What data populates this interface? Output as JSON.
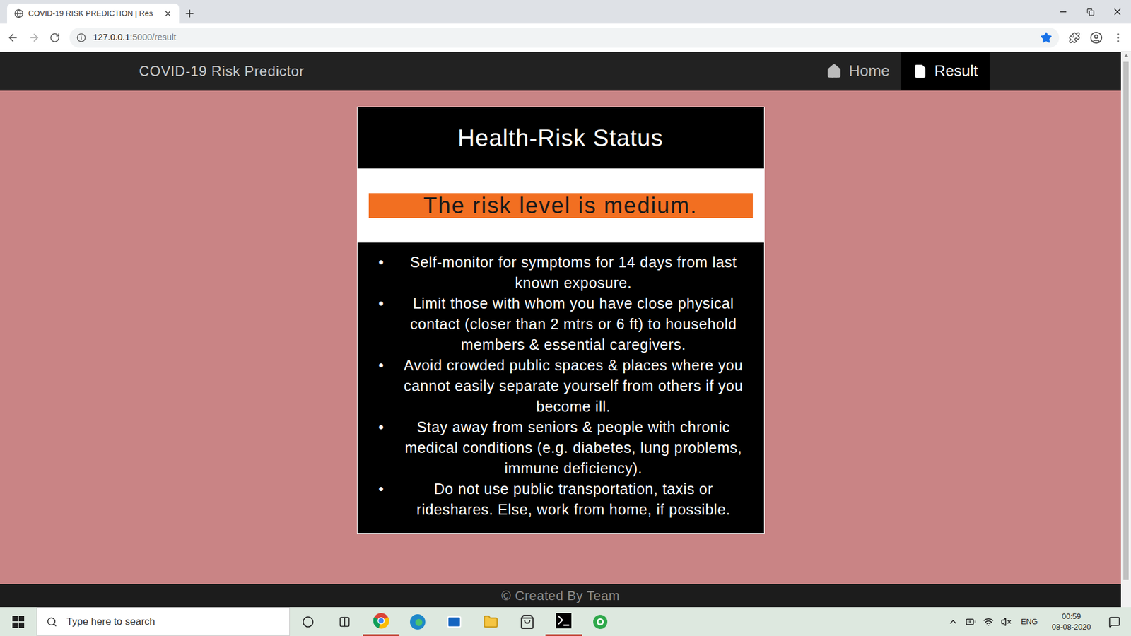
{
  "browser": {
    "tab": {
      "title": "COVID-19 RISK PREDICTION | Res"
    },
    "address": {
      "host": "127.0.0.1",
      "path": ":5000/result"
    },
    "bookmarked": true
  },
  "navbar": {
    "brand": "COVID-19 Risk Predictor",
    "links": [
      {
        "label": "Home",
        "selected": false
      },
      {
        "label": "Result",
        "selected": true
      }
    ]
  },
  "card": {
    "title": "Health-Risk Status",
    "risk": {
      "text": "The risk level is medium.",
      "color": "#f26f21"
    },
    "advice": [
      "Self-monitor for symptoms for 14 days from last known exposure.",
      "Limit those with whom you have close physical contact (closer than 2 mtrs or 6 ft) to household members & essential caregivers.",
      "Avoid crowded public spaces & places where you cannot easily separate yourself from others if you become ill.",
      "Stay away from seniors & people with chronic medical conditions (e.g. diabetes, lung problems, immune deficiency).",
      "Do not use public transportation, taxis or rideshares. Else, work from home, if possible."
    ]
  },
  "footer": "© Created By Team",
  "taskbar": {
    "search_placeholder": "Type here to search",
    "language": "ENG",
    "time": "00:59",
    "date": "08-08-2020"
  }
}
